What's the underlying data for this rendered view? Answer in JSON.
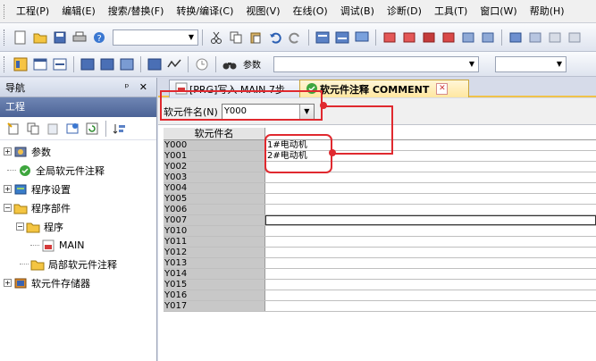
{
  "menubar": {
    "items": [
      "工程(P)",
      "编辑(E)",
      "搜索/替换(F)",
      "转换/编译(C)",
      "视图(V)",
      "在线(O)",
      "调试(B)",
      "诊断(D)",
      "工具(T)",
      "窗口(W)",
      "帮助(H)"
    ]
  },
  "toolbar": {
    "device_label": "参数"
  },
  "navigation": {
    "title": "导航",
    "pin_close": "ᵖ ✕",
    "project_header": "工程",
    "tree": [
      {
        "label": "参数"
      },
      {
        "label": "全局软元件注释"
      },
      {
        "label": "程序设置"
      },
      {
        "label": "程序部件"
      },
      {
        "label": "程序"
      },
      {
        "label": "MAIN"
      },
      {
        "label": "局部软元件注释"
      },
      {
        "label": "软元件存储器"
      }
    ]
  },
  "tabs": [
    {
      "label": "[PRG]写入 MAIN 7步"
    },
    {
      "label": "软元件注释 COMMENT",
      "close": "✕"
    }
  ],
  "comment_editor": {
    "device_name_label": "软元件名(N)",
    "device_name_value": "Y000",
    "column_device": "软元件名",
    "rows": [
      {
        "device": "Y000",
        "comment": "1#电动机"
      },
      {
        "device": "Y001",
        "comment": "2#电动机"
      },
      {
        "device": "Y002",
        "comment": ""
      },
      {
        "device": "Y003",
        "comment": ""
      },
      {
        "device": "Y004",
        "comment": ""
      },
      {
        "device": "Y005",
        "comment": ""
      },
      {
        "device": "Y006",
        "comment": ""
      },
      {
        "device": "Y007",
        "comment": ""
      },
      {
        "device": "Y010",
        "comment": ""
      },
      {
        "device": "Y011",
        "comment": ""
      },
      {
        "device": "Y012",
        "comment": ""
      },
      {
        "device": "Y013",
        "comment": ""
      },
      {
        "device": "Y014",
        "comment": ""
      },
      {
        "device": "Y015",
        "comment": ""
      },
      {
        "device": "Y016",
        "comment": ""
      },
      {
        "device": "Y017",
        "comment": ""
      }
    ]
  },
  "colors": {
    "annotation": "#e0292f",
    "project_header": "#5a72a6",
    "tab_active": "#ffe7a0"
  }
}
